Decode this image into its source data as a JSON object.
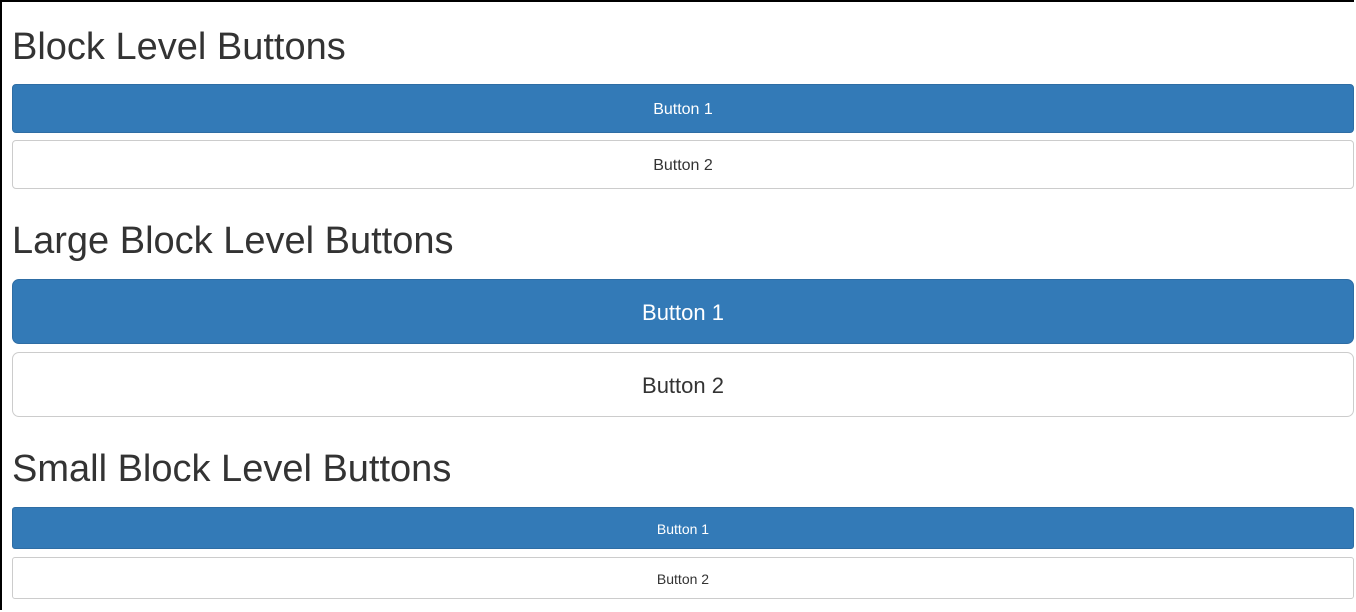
{
  "sections": {
    "default": {
      "heading": "Block Level Buttons",
      "button_1": "Button 1",
      "button_2": "Button 2"
    },
    "large": {
      "heading": "Large Block Level Buttons",
      "button_1": "Button 1",
      "button_2": "Button 2"
    },
    "small": {
      "heading": "Small Block Level Buttons",
      "button_1": "Button 1",
      "button_2": "Button 2"
    }
  },
  "colors": {
    "primary": "#337ab7",
    "primary_border": "#2e6da4",
    "default_bg": "#ffffff",
    "default_border": "#cccccc",
    "text": "#333333"
  }
}
